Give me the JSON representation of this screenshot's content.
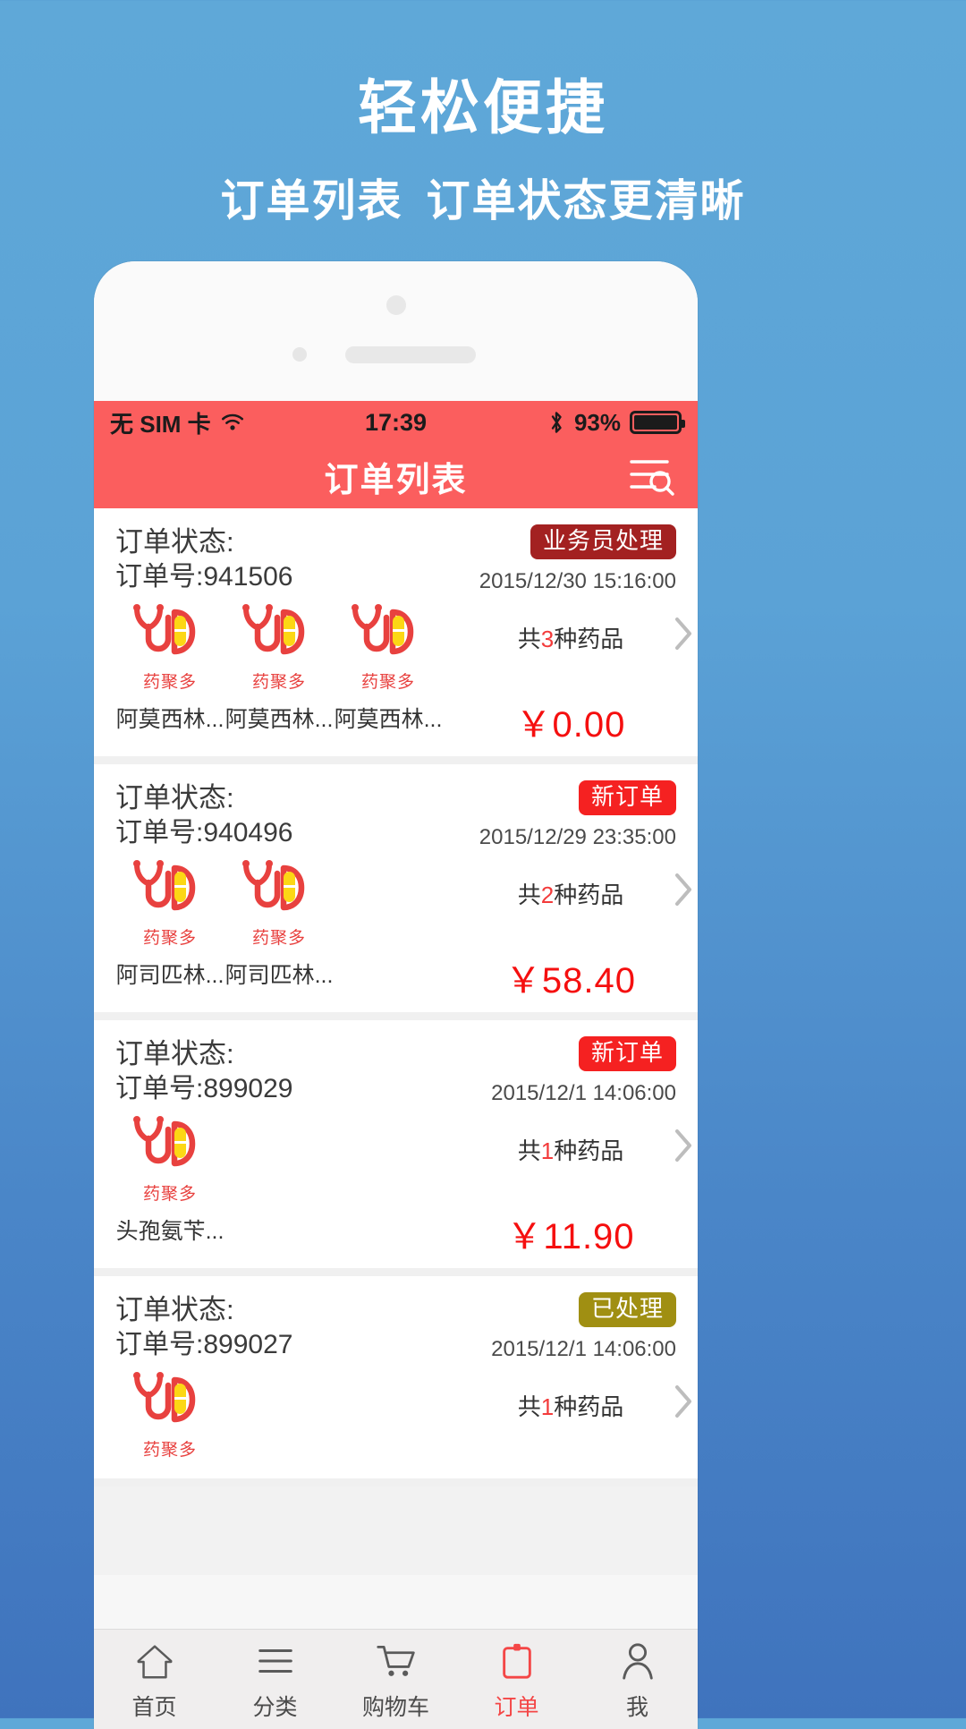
{
  "promo": {
    "title": "轻松便捷",
    "subtitle_left": "订单列表",
    "subtitle_right": "订单状态更清晰"
  },
  "status_bar": {
    "carrier": "无 SIM 卡",
    "wifi_icon": "wifi-icon",
    "time": "17:39",
    "bluetooth_icon": "bluetooth-icon",
    "battery_percent": "93%",
    "battery_icon": "battery-full-icon"
  },
  "navbar": {
    "title": "订单列表",
    "action_icon": "list-search-icon"
  },
  "colors": {
    "brand_red": "#fb5e5e",
    "badge_new": "#f52121",
    "badge_processing": "#a32121",
    "badge_done": "#a08f12",
    "price_red": "#f50f0f",
    "page_bg_top": "#5fa8d8",
    "page_bg_bottom": "#3f73bd"
  },
  "orders": [
    {
      "status_label": "订单状态:",
      "order_no": "订单号:941506",
      "badge": "业务员处理",
      "badge_style": "dark",
      "date": "2015/12/30 15:16:00",
      "items": [
        "阿莫西林...",
        "阿莫西林...",
        "阿莫西林..."
      ],
      "count_prefix": "共",
      "count_value": "3",
      "count_suffix": "种药品",
      "price": "￥0.00",
      "chevron_icon": "chevron-right-icon",
      "logo_text": "药聚多"
    },
    {
      "status_label": "订单状态:",
      "order_no": "订单号:940496",
      "badge": "新订单",
      "badge_style": "red",
      "date": "2015/12/29 23:35:00",
      "items": [
        "阿司匹林...",
        "阿司匹林..."
      ],
      "count_prefix": "共",
      "count_value": "2",
      "count_suffix": "种药品",
      "price": "￥58.40",
      "chevron_icon": "chevron-right-icon",
      "logo_text": "药聚多"
    },
    {
      "status_label": "订单状态:",
      "order_no": "订单号:899029",
      "badge": "新订单",
      "badge_style": "red",
      "date": "2015/12/1 14:06:00",
      "items": [
        "头孢氨苄..."
      ],
      "count_prefix": "共",
      "count_value": "1",
      "count_suffix": "种药品",
      "price": "￥11.90",
      "chevron_icon": "chevron-right-icon",
      "logo_text": "药聚多"
    },
    {
      "status_label": "订单状态:",
      "order_no": "订单号:899027",
      "badge": "已处理",
      "badge_style": "olive",
      "date": "2015/12/1 14:06:00",
      "items": [
        ""
      ],
      "count_prefix": "共",
      "count_value": "1",
      "count_suffix": "种药品",
      "price": "",
      "chevron_icon": "chevron-right-icon",
      "logo_text": "药聚多"
    }
  ],
  "tabbar": [
    {
      "label": "首页",
      "icon": "home-icon",
      "active": false
    },
    {
      "label": "分类",
      "icon": "category-icon",
      "active": false
    },
    {
      "label": "购物车",
      "icon": "cart-icon",
      "active": false
    },
    {
      "label": "订单",
      "icon": "order-icon",
      "active": true
    },
    {
      "label": "我",
      "icon": "user-icon",
      "active": false
    }
  ]
}
